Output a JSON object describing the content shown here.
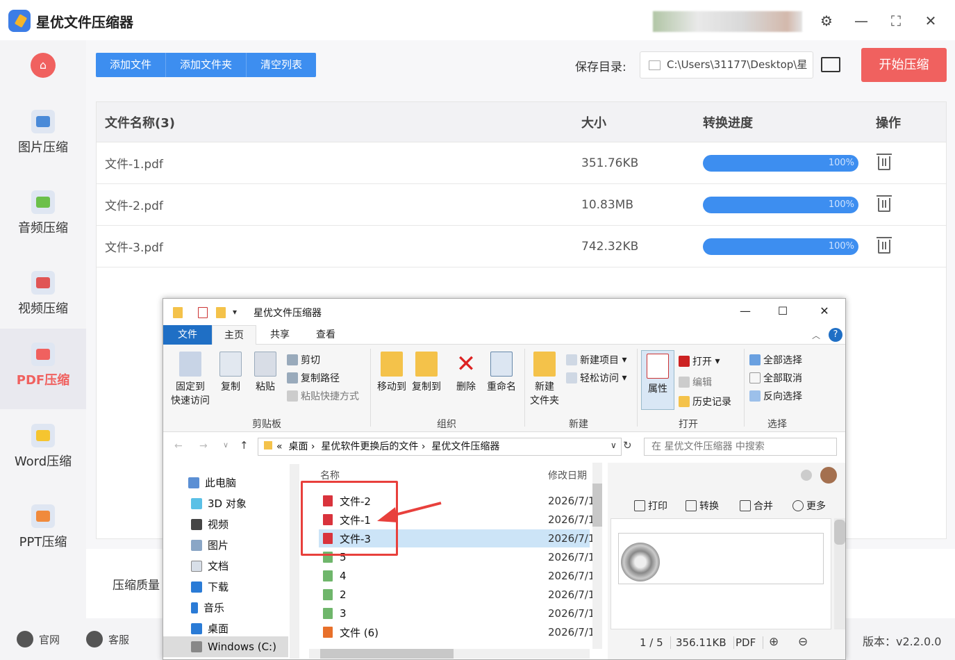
{
  "app": {
    "title": "星优文件压缩器"
  },
  "toolbar": {
    "add_file": "添加文件",
    "add_folder": "添加文件夹",
    "clear_list": "清空列表",
    "save_label": "保存目录:",
    "save_path": "C:\\Users\\31177\\Desktop\\星",
    "start": "开始压缩"
  },
  "sidebar": {
    "items": [
      {
        "label": "图片压缩",
        "icon": "image-icon"
      },
      {
        "label": "音频压缩",
        "icon": "audio-icon"
      },
      {
        "label": "视频压缩",
        "icon": "video-icon"
      },
      {
        "label": "PDF压缩",
        "icon": "pdf-icon",
        "active": true
      },
      {
        "label": "Word压缩",
        "icon": "word-icon"
      },
      {
        "label": "PPT压缩",
        "icon": "ppt-icon"
      }
    ]
  },
  "table": {
    "headers": {
      "name": "文件名称(3)",
      "size": "大小",
      "progress": "转换进度",
      "action": "操作"
    },
    "rows": [
      {
        "name": "文件-1.pdf",
        "size": "351.76KB",
        "progress": "100%"
      },
      {
        "name": "文件-2.pdf",
        "size": "10.83MB",
        "progress": "100%"
      },
      {
        "name": "文件-3.pdf",
        "size": "742.32KB",
        "progress": "100%"
      }
    ]
  },
  "bottom": {
    "quality_label": "压缩质量"
  },
  "footer": {
    "website": "官网",
    "service": "客服",
    "version": "版本：v2.2.0.0"
  },
  "explorer": {
    "title": "星优文件压缩器",
    "tabs": {
      "file": "文件",
      "home": "主页",
      "share": "共享",
      "view": "查看"
    },
    "ribbon": {
      "pin": "固定到\n快速访问",
      "pin1": "固定到",
      "pin2": "快速访问",
      "copy": "复制",
      "paste": "粘贴",
      "cut": "剪切",
      "copy_path": "复制路径",
      "paste_shortcut": "粘贴快捷方式",
      "clipboard": "剪贴板",
      "move_to": "移动到",
      "copy_to": "复制到",
      "delete": "删除",
      "rename": "重命名",
      "organize": "组织",
      "new_folder1": "新建",
      "new_folder2": "文件夹",
      "new_item": "新建项目",
      "easy_access": "轻松访问",
      "new": "新建",
      "properties": "属性",
      "open": "打开",
      "edit": "编辑",
      "history": "历史记录",
      "open_group": "打开",
      "select_all": "全部选择",
      "select_none": "全部取消",
      "invert": "反向选择",
      "select": "选择"
    },
    "address": {
      "crumb1": "桌面",
      "crumb2": "星优软件更换后的文件",
      "crumb3": "星优文件压缩器",
      "search_placeholder": "在 星优文件压缩器 中搜索"
    },
    "nav": [
      "此电脑",
      "3D 对象",
      "视频",
      "图片",
      "文档",
      "下载",
      "音乐",
      "桌面",
      "Windows (C:)"
    ],
    "columns": {
      "name": "名称",
      "date": "修改日期"
    },
    "files": [
      {
        "name": "文件-2",
        "date": "2026/7/1"
      },
      {
        "name": "文件-1",
        "date": "2026/7/1"
      },
      {
        "name": "文件-3",
        "date": "2026/7/1",
        "selected": true
      },
      {
        "name": "5",
        "date": "2026/7/1"
      },
      {
        "name": "4",
        "date": "2026/7/1"
      },
      {
        "name": "2",
        "date": "2026/7/1"
      },
      {
        "name": "3",
        "date": "2026/7/1"
      },
      {
        "name": "文件 (6)",
        "date": "2026/7/1"
      }
    ],
    "preview": {
      "print": "打印",
      "convert": "转换",
      "merge": "合并",
      "more": "更多",
      "page": "1 / 5",
      "size": "356.11KB",
      "format": "PDF"
    }
  }
}
